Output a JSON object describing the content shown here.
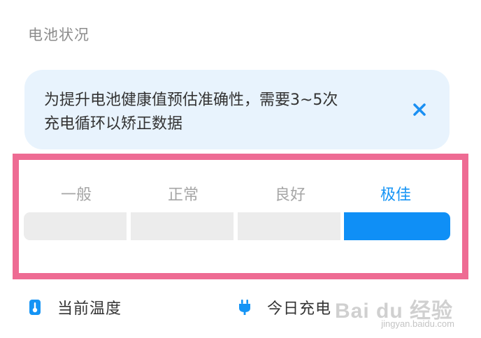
{
  "section": {
    "title": "电池状况"
  },
  "notice": {
    "line1": "为提升电池健康值预估准确性，需要3~5次",
    "line2": "充电循环以矫正数据",
    "close_icon": "close-icon"
  },
  "health_scale": {
    "levels": [
      {
        "label": "一般",
        "active": false
      },
      {
        "label": "正常",
        "active": false
      },
      {
        "label": "良好",
        "active": false
      },
      {
        "label": "极佳",
        "active": true
      }
    ],
    "current_level": "极佳",
    "active_color": "#0f8ff6",
    "inactive_color": "#ececec",
    "highlight_color": "#ee6b93"
  },
  "stats": {
    "temperature": {
      "icon": "thermometer-icon",
      "label": "当前温度"
    },
    "charge_today": {
      "icon": "plug-icon",
      "label": "今日充电"
    }
  },
  "watermark": {
    "logo": "Bai du 经验",
    "url": "jingyan.baidu.com"
  }
}
